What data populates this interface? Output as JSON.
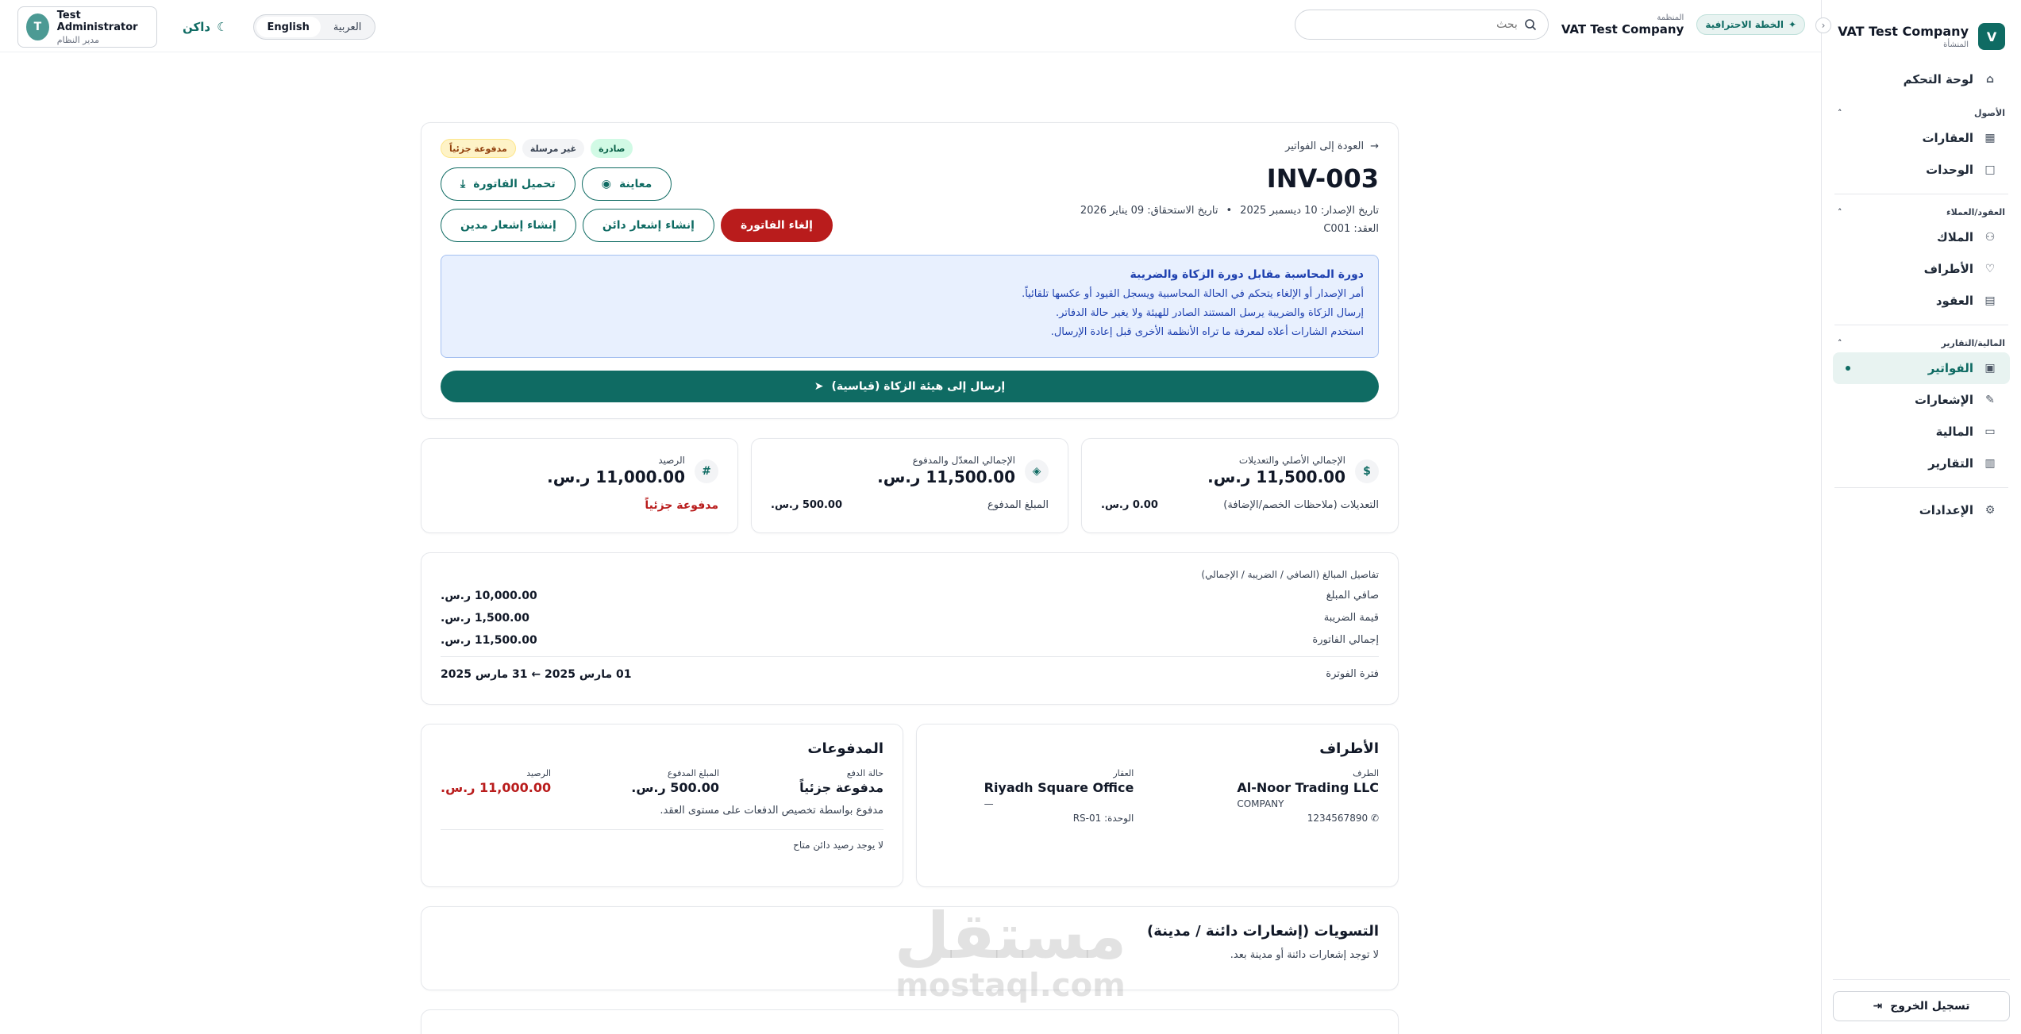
{
  "sidebar": {
    "logo_letter": "V",
    "company_name": "VAT Test Company",
    "company_sub": "المنشأة",
    "items": {
      "dashboard": "لوحة التحكم",
      "properties": "العقارات",
      "units": "الوحدات",
      "owners": "الملاك",
      "parties": "الأطراف",
      "contracts": "العقود",
      "invoices": "الفواتير",
      "notices": "الإشعارات",
      "finance": "المالية",
      "reports": "التقارير",
      "settings": "الإعدادات"
    },
    "groups": {
      "assets": "الأصول",
      "contracts_clients": "العقود/العملاء",
      "finance_reports": "المالية/التقارير"
    },
    "logout": "تسجيل الخروج"
  },
  "topbar": {
    "plan_badge": "الخطة الاحترافية",
    "org_label": "المنظمة",
    "org_name": "VAT Test Company",
    "search_placeholder": "بحث",
    "lang_ar": "العربية",
    "lang_en": "English",
    "theme_label": "داكن",
    "user_initial": "T",
    "user_name": "Test Administrator",
    "user_role": "مدير النظام"
  },
  "invoice": {
    "back_label": "العودة إلى الفواتير",
    "number": "INV-003",
    "issue_date": "تاريخ الإصدار: 10 ديسمبر 2025",
    "due_date": "تاريخ الاستحقاق: 09 يناير 2026",
    "contract": "العقد: C001",
    "badges": {
      "issued": "صادرة",
      "unsent": "غير مرسلة",
      "partial": "مدفوعة جزئياً"
    },
    "buttons": {
      "preview": "معاينة",
      "download": "تحميل الفاتورة",
      "cancel": "إلغاء الفاتورة",
      "credit_note": "إنشاء إشعار دائن",
      "debit_note": "إنشاء إشعار مدين",
      "send_zatca": "إرسال إلى هيئة الزكاة (قياسية)"
    },
    "info": {
      "title": "دورة المحاسبة مقابل دورة الزكاة والضريبة",
      "line1": "أمر الإصدار أو الإلغاء يتحكم في الحالة المحاسبية ويسجل القيود أو عكسها تلقائياً.",
      "line2": "إرسال الزكاة والضريبة يرسل المستند الصادر للهيئة ولا يغير حالة الدفاتر.",
      "line3": "استخدم الشارات أعلاه لمعرفة ما تراه الأنظمة الأخرى قبل إعادة الإرسال."
    }
  },
  "stats": {
    "total_original": {
      "label": "الإجمالي الأصلي والتعديلات",
      "value": "11,500.00 ر.س.",
      "sub_label": "التعديلات (ملاحظات الخصم/الإضافة)",
      "sub_value": "0.00 ر.س."
    },
    "total_effective": {
      "label": "الإجمالي المعدّل والمدفوع",
      "value": "11,500.00 ر.س.",
      "sub_label": "المبلغ المدفوع",
      "sub_value": "500.00 ر.س."
    },
    "balance": {
      "label": "الرصيد",
      "value": "11,000.00 ر.س.",
      "status": "مدفوعة جزئياً"
    }
  },
  "amounts": {
    "heading": "تفاصيل المبالغ (الصافي / الضريبة / الإجمالي)",
    "net_label": "صافي المبلغ",
    "net_value": "10,000.00 ر.س.",
    "vat_label": "قيمة الضريبة",
    "vat_value": "1,500.00 ر.س.",
    "total_label": "إجمالي الفاتورة",
    "total_value": "11,500.00 ر.س.",
    "period_label": "فترة الفوترة",
    "period_value": "01 مارس 2025 ← 31 مارس 2025"
  },
  "parties": {
    "title": "الأطراف",
    "party_label": "الطرف",
    "party_name": "Al-Noor Trading LLC",
    "party_type": "COMPANY",
    "party_phone": "1234567890",
    "property_label": "العقار",
    "property_name": "Riyadh Square Office",
    "property_dash": "—",
    "unit": "الوحدة: RS-01"
  },
  "payments": {
    "title": "المدفوعات",
    "status_label": "حالة الدفع",
    "status_value": "مدفوعة جزئياً",
    "paid_label": "المبلغ المدفوع",
    "paid_value": "500.00 ر.س.",
    "balance_label": "الرصيد",
    "balance_value": "11,000.00 ر.س.",
    "note": "مدفوع بواسطة تخصيص الدفعات على مستوى العقد.",
    "credit_note": "لا يوجد رصيد دائن متاح"
  },
  "settlements": {
    "title": "التسويات (إشعارات دائنة / مدينة)",
    "empty": "لا توجد إشعارات دائنة أو مدينة بعد."
  },
  "watermark": {
    "arabic": "مستقل",
    "latin": "mostaql.com"
  },
  "colors": {
    "brand": "#0f6b63",
    "danger": "#b91c1c",
    "info_bg": "#e8f0fe"
  }
}
